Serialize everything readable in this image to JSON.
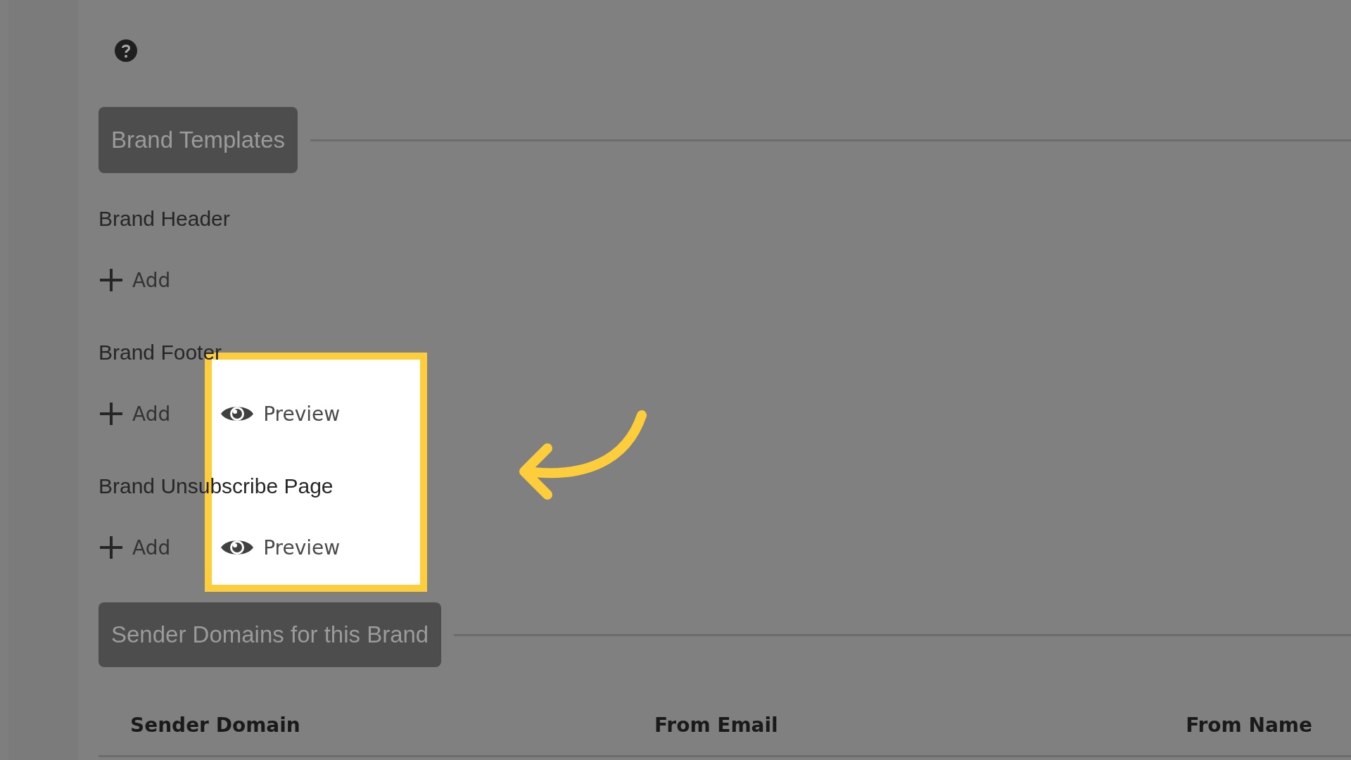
{
  "sections": [
    {
      "title": "Brand Templates",
      "items": [
        {
          "label": "Brand Header",
          "actions": [
            {
              "kind": "add",
              "label": "Add",
              "highlighted": false
            }
          ]
        },
        {
          "label": "Brand Footer",
          "actions": [
            {
              "kind": "add",
              "label": "Add",
              "highlighted": false
            },
            {
              "kind": "preview",
              "label": "Preview",
              "highlighted": true
            }
          ]
        },
        {
          "label": "Brand Unsubscribe Page",
          "actions": [
            {
              "kind": "add",
              "label": "Add",
              "highlighted": false
            },
            {
              "kind": "preview",
              "label": "Preview",
              "highlighted": true
            }
          ]
        }
      ]
    }
  ],
  "sender_domains": {
    "title": "Sender Domains for this Brand",
    "table": {
      "columns": [
        "Sender Domain",
        "From Email",
        "From Name"
      ]
    }
  }
}
